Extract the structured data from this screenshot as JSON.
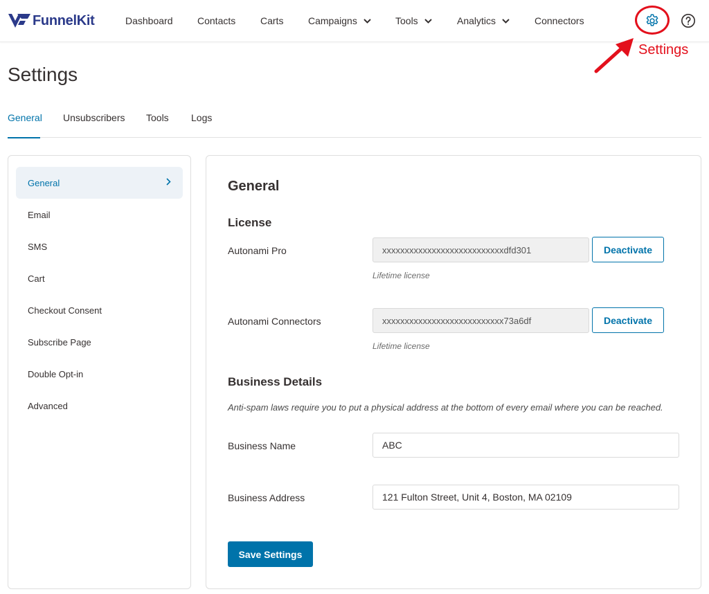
{
  "brand": {
    "name": "FunnelKit",
    "accent": "#0073aa",
    "logo_mark_color": "#2b3a8a"
  },
  "nav": {
    "items": [
      {
        "label": "Dashboard",
        "has_dropdown": false
      },
      {
        "label": "Contacts",
        "has_dropdown": false
      },
      {
        "label": "Carts",
        "has_dropdown": false
      },
      {
        "label": "Campaigns",
        "has_dropdown": true
      },
      {
        "label": "Tools",
        "has_dropdown": true
      },
      {
        "label": "Analytics",
        "has_dropdown": true
      },
      {
        "label": "Connectors",
        "has_dropdown": false
      }
    ],
    "settings_icon": "gear-icon",
    "help_icon": "question-circle-icon"
  },
  "annotation": {
    "label": "Settings",
    "color": "#e3101c"
  },
  "page": {
    "title": "Settings",
    "tabs": [
      {
        "label": "General",
        "active": true
      },
      {
        "label": "Unsubscribers",
        "active": false
      },
      {
        "label": "Tools",
        "active": false
      },
      {
        "label": "Logs",
        "active": false
      }
    ]
  },
  "sidebar": {
    "items": [
      {
        "label": "General",
        "active": true
      },
      {
        "label": "Email",
        "active": false
      },
      {
        "label": "SMS",
        "active": false
      },
      {
        "label": "Cart",
        "active": false
      },
      {
        "label": "Checkout Consent",
        "active": false
      },
      {
        "label": "Subscribe Page",
        "active": false
      },
      {
        "label": "Double Opt-in",
        "active": false
      },
      {
        "label": "Advanced",
        "active": false
      }
    ]
  },
  "general": {
    "title": "General",
    "license": {
      "title": "License",
      "items": [
        {
          "label": "Autonami Pro",
          "key": "xxxxxxxxxxxxxxxxxxxxxxxxxxxdfd301",
          "button": "Deactivate",
          "hint": "Lifetime license"
        },
        {
          "label": "Autonami Connectors",
          "key": "xxxxxxxxxxxxxxxxxxxxxxxxxxx73a6df",
          "button": "Deactivate",
          "hint": "Lifetime license"
        }
      ]
    },
    "business": {
      "title": "Business Details",
      "note": "Anti-spam laws require you to put a physical address at the bottom of every email where you can be reached.",
      "name_label": "Business Name",
      "name_value": "ABC",
      "address_label": "Business Address",
      "address_value": "121 Fulton Street, Unit 4, Boston, MA 02109"
    },
    "save_button": "Save Settings"
  }
}
